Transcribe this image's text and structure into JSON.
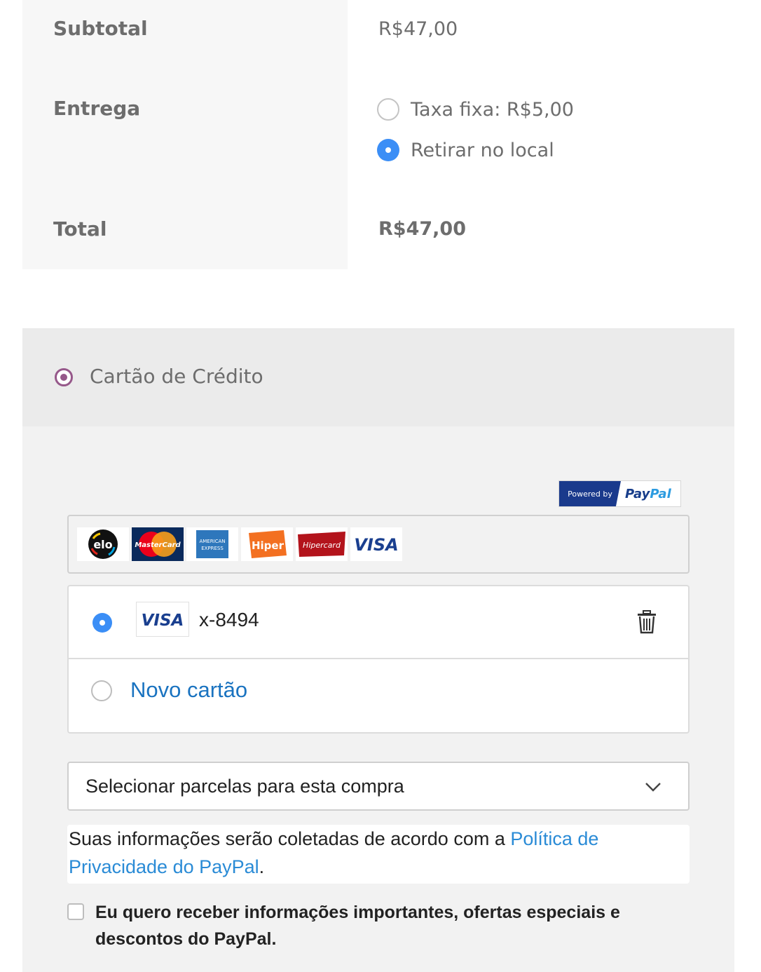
{
  "totals": {
    "subtotal_label": "Subtotal",
    "subtotal_value": "R$47,00",
    "shipping_label": "Entrega",
    "shipping_options": [
      {
        "label": "Taxa fixa: R$5,00",
        "selected": false
      },
      {
        "label": "Retirar no local",
        "selected": true
      }
    ],
    "total_label": "Total",
    "total_value": "R$47,00"
  },
  "payment": {
    "method_title": "Cartão de Crédito",
    "powered_by": "Powered by",
    "paypal_pay": "Pay",
    "paypal_pal": "Pal",
    "brands": [
      "elo",
      "mastercard",
      "american-express",
      "hiper",
      "hipercard",
      "visa"
    ],
    "brand_texts": {
      "elo": "elo",
      "mastercard": "MasterCard",
      "amex": "AMERICAN EXPRESS",
      "hiper": "Hiper",
      "hipercard": "Hipercard",
      "visa": "VISA"
    },
    "saved_card": {
      "brand": "VISA",
      "number": "x-8494",
      "selected": true
    },
    "new_card_label": "Novo cartão",
    "installments_placeholder": "Selecionar parcelas para esta compra",
    "privacy_text": "Suas informações serão coletadas de acordo com a ",
    "privacy_link": "Política de Privacidade do PayPal",
    "privacy_end": ".",
    "optin_text": "Eu quero receber informações importantes, ofertas especiais e descontos do PayPal.",
    "optin_checked": false
  },
  "colors": {
    "accent_radio": "#3b8ef6",
    "woo_purple": "#96588a",
    "link_blue": "#1a73c0"
  }
}
